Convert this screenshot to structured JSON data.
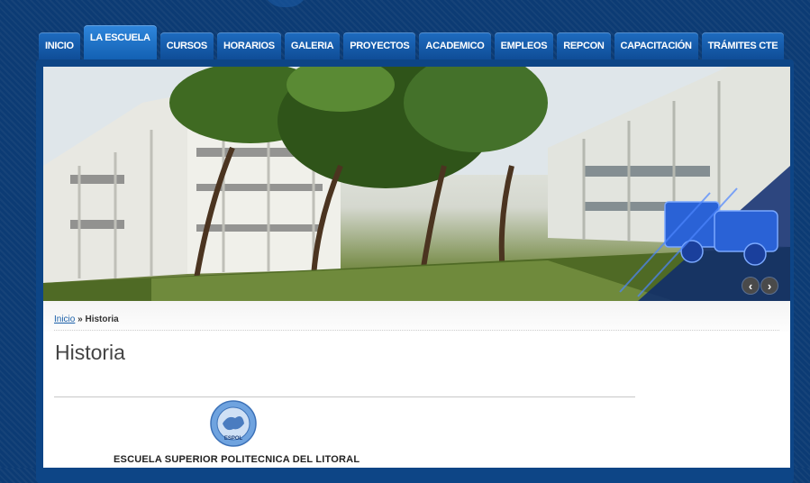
{
  "nav": {
    "tabs": [
      {
        "label": "INICIO"
      },
      {
        "label": "LA ESCUELA",
        "active": true
      },
      {
        "label": "CURSOS"
      },
      {
        "label": "HORARIOS"
      },
      {
        "label": "GALERIA"
      },
      {
        "label": "PROYECTOS"
      },
      {
        "label": "ACADEMICO"
      },
      {
        "label": "EMPLEOS"
      },
      {
        "label": "REPCON"
      },
      {
        "label": "CAPACITACIÓN"
      },
      {
        "label": "TRÁMITES CTE"
      }
    ]
  },
  "slider": {
    "prev_label": "‹",
    "next_label": "›"
  },
  "breadcrumb": {
    "home": "Inicio",
    "separator": " » ",
    "current": "Historia"
  },
  "page": {
    "title": "Historia",
    "seal_text": "ESPOL",
    "institution": "ESCUELA SUPERIOR POLITECNICA DEL LITORAL"
  },
  "colors": {
    "background": "#0c3b74",
    "tab": "#1466b8",
    "link": "#1a5fa8"
  }
}
